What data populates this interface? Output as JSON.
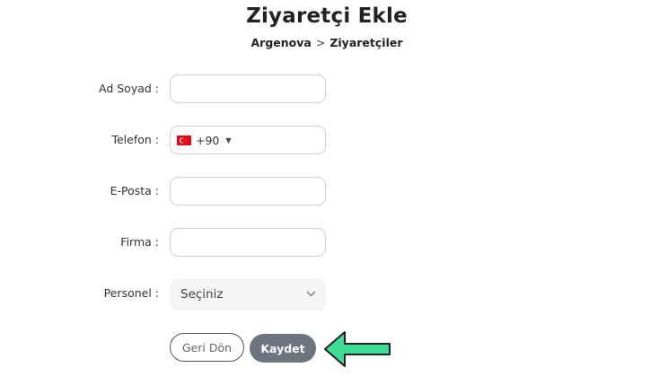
{
  "page": {
    "title": "Ziyaretçi Ekle",
    "breadcrumb": {
      "root": "Argenova",
      "separator": ">",
      "current": "Ziyaretçiler"
    }
  },
  "form": {
    "name": {
      "label": "Ad Soyad :",
      "value": ""
    },
    "phone": {
      "label": "Telefon :",
      "country_code": "+90",
      "country_flag": "turkey-flag-icon",
      "value": ""
    },
    "email": {
      "label": "E-Posta :",
      "value": ""
    },
    "company": {
      "label": "Firma :",
      "value": ""
    },
    "staff": {
      "label": "Personel :",
      "selected": "Seçiniz"
    }
  },
  "actions": {
    "back_label": "Geri Dön",
    "save_label": "Kaydet"
  },
  "annotation": {
    "arrow_icon": "left-arrow-icon",
    "color": "#3ddc97",
    "outline": "#222222"
  },
  "colors": {
    "save_button": "#6c757d",
    "flag_red": "#e30a17"
  }
}
